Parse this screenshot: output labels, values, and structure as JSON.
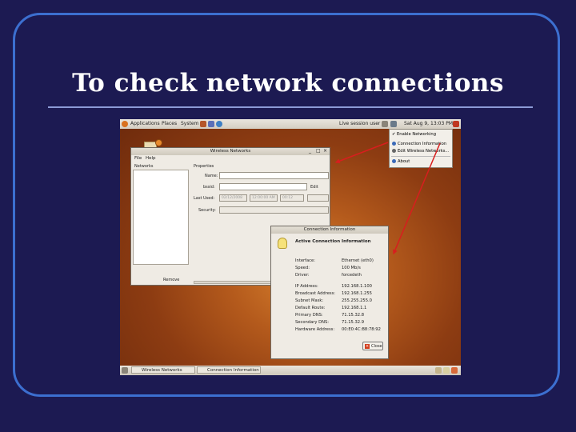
{
  "slide": {
    "title": "To check network connections"
  },
  "top_panel": {
    "menus": [
      "Applications",
      "Places",
      "System"
    ],
    "session": "Live session user",
    "clock": "Sat Aug 9, 13:03 PM"
  },
  "wireless_window": {
    "title": "Wireless Networks",
    "menu": [
      "File",
      "Help"
    ],
    "networks_header": "Networks",
    "properties_header": "Properties",
    "name_label": "Name:",
    "bssid_label": "bssid:",
    "last_used_label": "Last Used:",
    "security_label": "Security:",
    "edit_label": "Edit",
    "date_value": "02/12/2008",
    "time_value_1": "12:00:00 AM",
    "time_value_2": "00:12",
    "remove_label": "Remove"
  },
  "connection_dialog": {
    "title": "Connection Information",
    "heading": "Active Connection Information",
    "rows": [
      {
        "label": "Interface:",
        "value": "Ethernet (eth0)"
      },
      {
        "label": "Speed:",
        "value": "100 Mb/s"
      },
      {
        "label": "Driver:",
        "value": "forcedeth"
      },
      {
        "label": "IP Address:",
        "value": "192.168.1.100"
      },
      {
        "label": "Broadcast Address:",
        "value": "192.168.1.255"
      },
      {
        "label": "Subnet Mask:",
        "value": "255.255.255.0"
      },
      {
        "label": "Default Route:",
        "value": "192.168.1.1"
      },
      {
        "label": "Primary DNS:",
        "value": "71.15.32.8"
      },
      {
        "label": "Secondary DNS:",
        "value": "71.15.32.9"
      },
      {
        "label": "Hardware Address:",
        "value": "00:E0:4C:B8:78:92"
      }
    ],
    "close_label": "Close"
  },
  "network_menu": {
    "items": [
      "Enable Networking",
      "Connection Information",
      "Edit Wireless Networks...",
      "About"
    ]
  },
  "bottom_panel": {
    "tasks": [
      "Wireless Networks",
      "Connection Information"
    ]
  },
  "colors": {
    "background": "#1c1a52",
    "frame": "#3c6fd0",
    "arrow": "#d81e1e"
  }
}
